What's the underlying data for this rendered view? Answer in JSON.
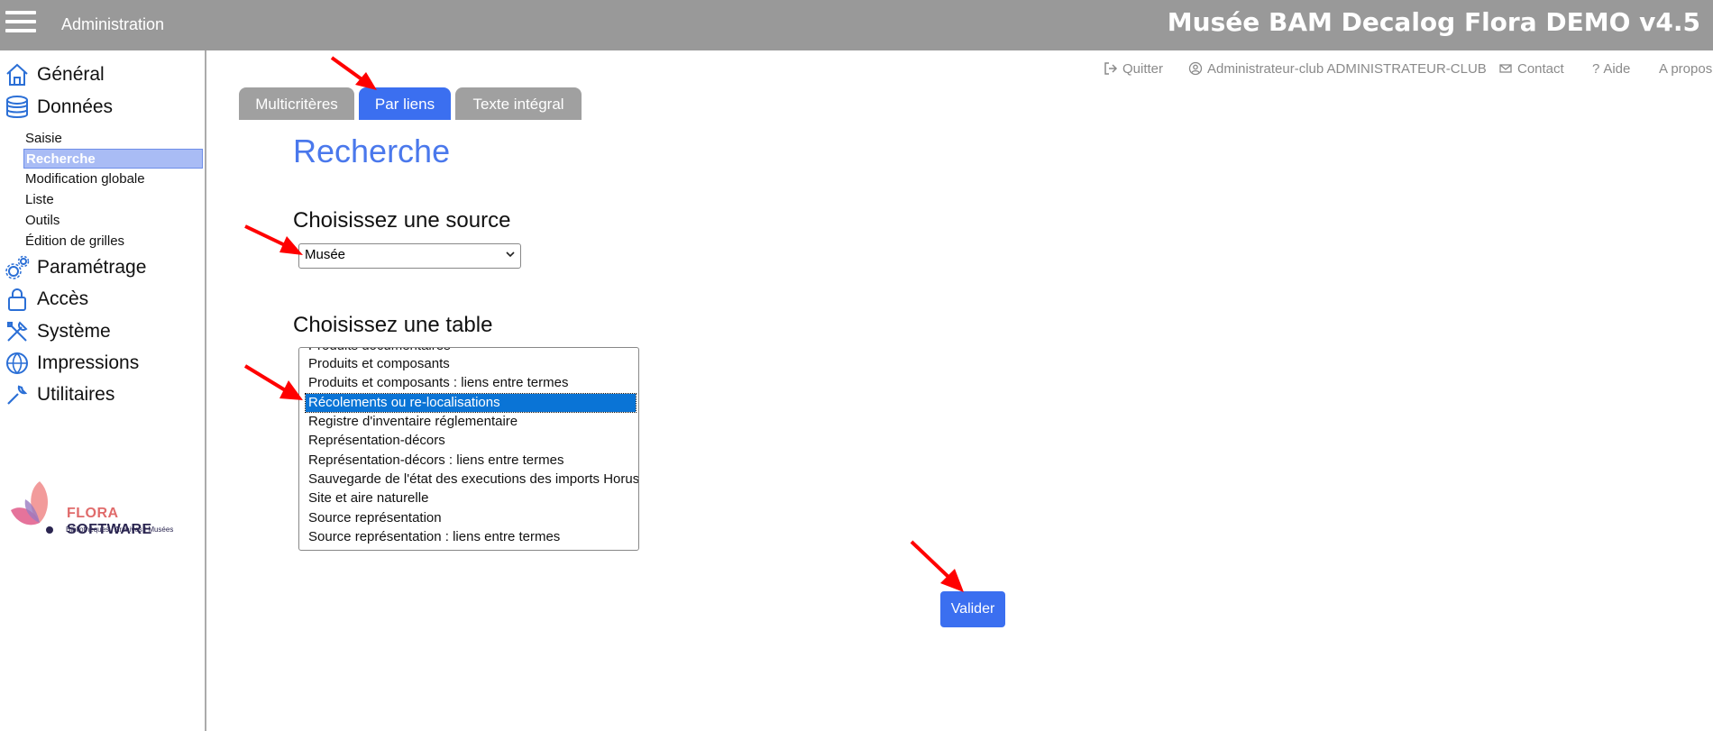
{
  "header": {
    "section": "Administration",
    "app_title": "Musée BAM Decalog Flora DEMO v4.5"
  },
  "sidebar": {
    "main": [
      {
        "label": "Général",
        "icon": "home-icon"
      },
      {
        "label": "Données",
        "icon": "database-icon"
      },
      {
        "label": "Paramétrage",
        "icon": "gears-icon"
      },
      {
        "label": "Accès",
        "icon": "lock-icon"
      },
      {
        "label": "Système",
        "icon": "tools-icon"
      },
      {
        "label": "Impressions",
        "icon": "globe-icon"
      },
      {
        "label": "Utilitaires",
        "icon": "wrench-icon"
      }
    ],
    "data_submenu": [
      "Saisie",
      "Recherche",
      "Modification globale",
      "Liste",
      "Outils",
      "Édition de grilles"
    ],
    "active_submenu": "Recherche"
  },
  "logo": {
    "brand_a": "FLORA",
    "brand_b": " SOFTWARE",
    "tagline": "Bibliothèques | Archives | Musées"
  },
  "utility_links": {
    "quit": "Quitter",
    "user": "Administrateur-club ADMINISTRATEUR-CLUB",
    "contact": "Contact",
    "help": "Aide",
    "about": "A propos"
  },
  "tabs": [
    {
      "label": "Multicritères",
      "active": false
    },
    {
      "label": "Par liens",
      "active": true
    },
    {
      "label": "Texte intégral",
      "active": false
    }
  ],
  "main": {
    "title": "Recherche",
    "source_heading": "Choisissez une source",
    "source_selected": "Musée",
    "table_heading": "Choisissez une table",
    "table_options": [
      "Produits documentaires",
      "Produits et composants",
      "Produits et composants : liens entre termes",
      "Récolements ou re-localisations",
      "Registre d'inventaire réglementaire",
      "Représentation-décors",
      "Représentation-décors : liens entre termes",
      "Sauvegarde de l'état des executions des imports Horus",
      "Site et aire naturelle",
      "Source représentation",
      "Source représentation : liens entre termes"
    ],
    "selected_table": "Récolements ou re-localisations",
    "submit_label": "Valider"
  },
  "colors": {
    "accent": "#3b6ff0",
    "header_bg": "#999999",
    "title_blue": "#4a78ec",
    "annotation_arrow": "#ff0000"
  }
}
